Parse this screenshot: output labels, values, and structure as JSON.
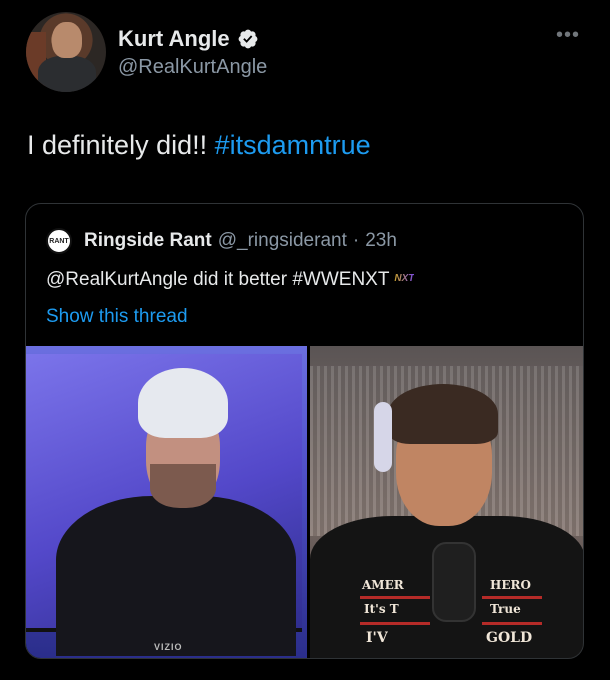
{
  "author": {
    "display_name": "Kurt Angle",
    "handle": "@RealKurtAngle",
    "verified_icon": "verified-badge-icon",
    "more_icon": "ellipsis-icon"
  },
  "tweet": {
    "text": "I definitely did!! ",
    "hashtag": "#itsdamntrue"
  },
  "quoted": {
    "avatar_text": "RANT",
    "name": "Ringside Rant",
    "handle": "@_ringsiderant",
    "separator": "·",
    "time": "23h",
    "text": "@RealKurtAngle did it better #WWENXT",
    "hashtag_icon_text": "NXT",
    "show_thread": "Show this thread",
    "image_left_brand": "VIZIO",
    "shirt_line1_left": "AMER",
    "shirt_line1_right": "HERO",
    "shirt_line2_left": "It's T",
    "shirt_line2_right": "True",
    "shirt_line3_left": "I'V",
    "shirt_line3_right": "GOLD"
  },
  "colors": {
    "background": "#000000",
    "link": "#1d9bf0",
    "secondary_text": "#8b98a5",
    "border": "#2f3336"
  }
}
